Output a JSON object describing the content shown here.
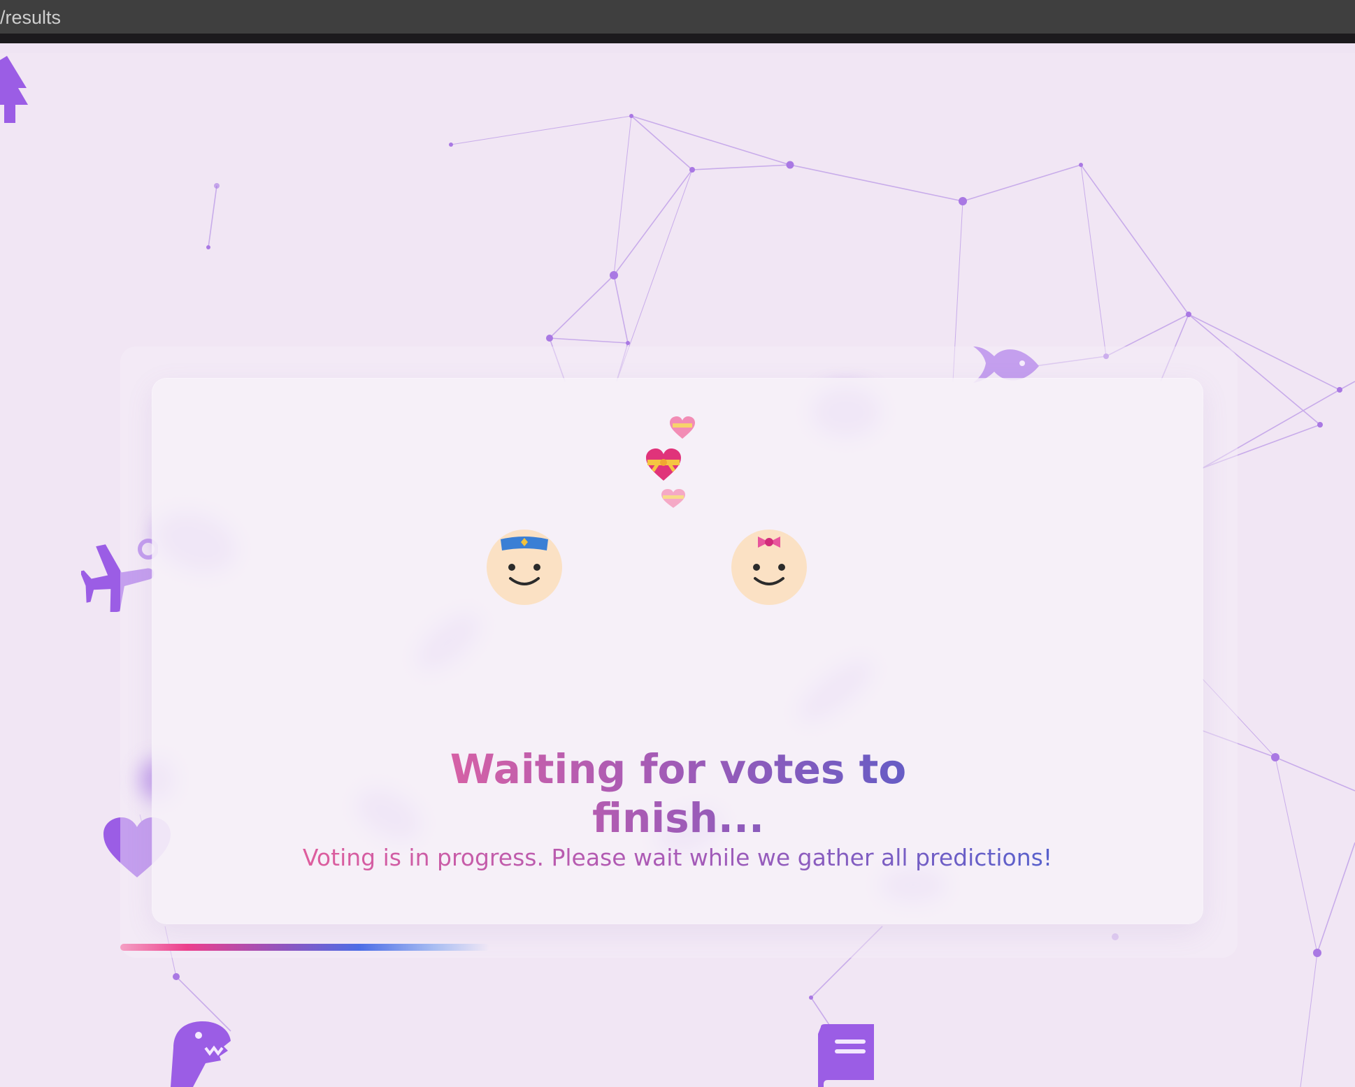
{
  "browser": {
    "url": "/results"
  },
  "main": {
    "heading": "Waiting for votes to finish...",
    "subtitle": "Voting is in progress. Please wait while we gather all predictions!",
    "progress_fraction": 0.33
  },
  "icons": {
    "float": [
      "tree-icon",
      "fish-icon",
      "airplane-icon",
      "heart-icon",
      "dinosaur-icon",
      "book-icon"
    ],
    "hearts": [
      "sparkling-heart-emoji",
      "heart-with-ribbon-emoji",
      "sparkling-heart-emoji"
    ],
    "faces": [
      "boy-face-icon",
      "girl-face-icon"
    ]
  },
  "colors": {
    "background": "#efe4f3",
    "accent_purple": "#9b5de5",
    "gradient_pink": "#e062a2",
    "gradient_blue": "#5b5cc8",
    "face_skin": "#fbe1c4"
  }
}
